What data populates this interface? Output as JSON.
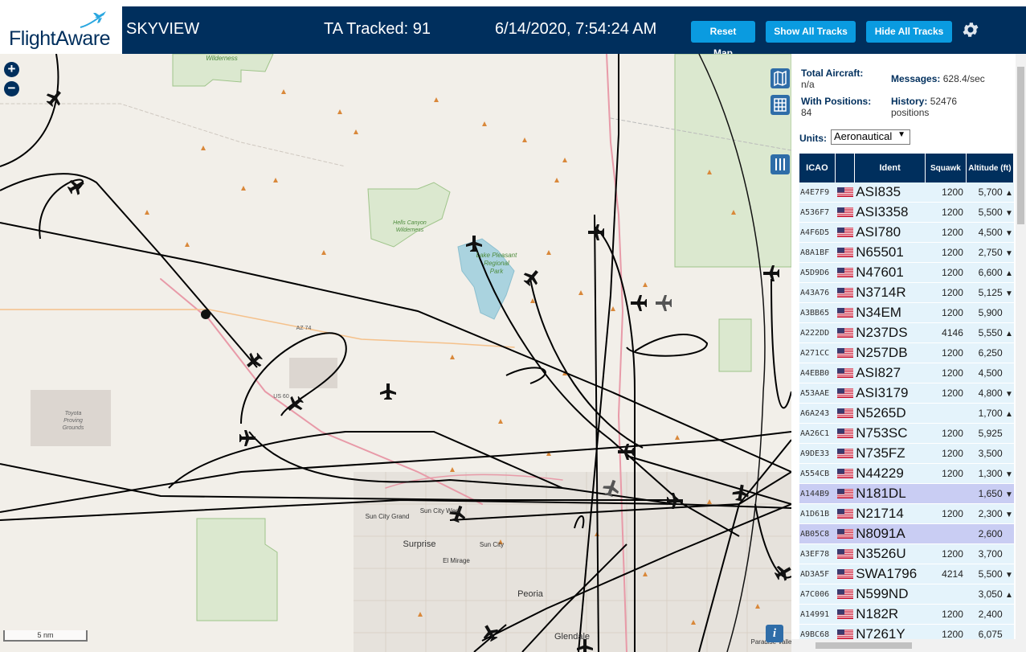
{
  "header": {
    "logo": "FlightAware",
    "app_title": "SKYVIEW",
    "ta_tracked": "TA Tracked: 91",
    "datetime": "6/14/2020, 7:54:24 AM",
    "buttons": {
      "reset_map": "Reset Map",
      "show_all_tracks": "Show All Tracks",
      "hide_all_tracks": "Hide All Tracks"
    },
    "settings_icon": "gear-icon",
    "background": "#002f5d",
    "button_color": "#0a9be0"
  },
  "map": {
    "zoom_in": "+",
    "zoom_out": "−",
    "scale": "5 nm",
    "info": "i",
    "labels": {
      "wilderness_top": "Wilderness",
      "hells_canyon": "Hells Canyon",
      "hells_canyon2": "Wilderness",
      "lake_pleasant": "Lake Pleasant",
      "regional": "Regional",
      "park": "Park",
      "toyota": "Toyota",
      "proving": "Proving",
      "grounds": "Grounds",
      "az74": "AZ 74",
      "us60": "US 60",
      "sun_city_grand": "Sun City Grand",
      "sun_city_west": "Sun City West",
      "sun_city": "Sun City",
      "surprise": "Surprise",
      "el_mirage": "El Mirage",
      "peoria": "Peoria",
      "glendale": "Glendale",
      "paradise_valley": "Paradise Valle"
    }
  },
  "sidebar": {
    "total_aircraft_label": "Total Aircraft:",
    "total_aircraft_value": "n/a",
    "with_positions_label": "With Positions:",
    "with_positions_value": "84",
    "messages_label": "Messages:",
    "messages_value": "628.4/sec",
    "history_label": "History:",
    "history_value": "52476",
    "history_unit": "positions",
    "units_label": "Units:",
    "units_value": "Aeronautical",
    "columns": [
      "ICAO",
      "",
      "Ident",
      "Squawk",
      "Altitude (ft)"
    ],
    "rows": [
      {
        "icao": "A4E7F9",
        "ident": "ASI835",
        "squawk": "1200",
        "altitude": "5,700",
        "trend": "▲"
      },
      {
        "icao": "A536F7",
        "ident": "ASI3358",
        "squawk": "1200",
        "altitude": "5,500",
        "trend": "▼"
      },
      {
        "icao": "A4F6D5",
        "ident": "ASI780",
        "squawk": "1200",
        "altitude": "4,500",
        "trend": "▼"
      },
      {
        "icao": "A8A1BF",
        "ident": "N65501",
        "squawk": "1200",
        "altitude": "2,750",
        "trend": "▼"
      },
      {
        "icao": "A5D9D6",
        "ident": "N47601",
        "squawk": "1200",
        "altitude": "6,600",
        "trend": "▲"
      },
      {
        "icao": "A43A76",
        "ident": "N3714R",
        "squawk": "1200",
        "altitude": "5,125",
        "trend": "▼"
      },
      {
        "icao": "A3BB65",
        "ident": "N34EM",
        "squawk": "1200",
        "altitude": "5,900",
        "trend": ""
      },
      {
        "icao": "A222DD",
        "ident": "N237DS",
        "squawk": "4146",
        "altitude": "5,550",
        "trend": "▲"
      },
      {
        "icao": "A271CC",
        "ident": "N257DB",
        "squawk": "1200",
        "altitude": "6,250",
        "trend": ""
      },
      {
        "icao": "A4EBB0",
        "ident": "ASI827",
        "squawk": "1200",
        "altitude": "4,500",
        "trend": ""
      },
      {
        "icao": "A53AAE",
        "ident": "ASI3179",
        "squawk": "1200",
        "altitude": "4,800",
        "trend": "▼"
      },
      {
        "icao": "A6A243",
        "ident": "N5265D",
        "squawk": "",
        "altitude": "1,700",
        "trend": "▲"
      },
      {
        "icao": "AA26C1",
        "ident": "N753SC",
        "squawk": "1200",
        "altitude": "5,925",
        "trend": ""
      },
      {
        "icao": "A9DE33",
        "ident": "N735FZ",
        "squawk": "1200",
        "altitude": "3,500",
        "trend": ""
      },
      {
        "icao": "A554CB",
        "ident": "N44229",
        "squawk": "1200",
        "altitude": "1,300",
        "trend": "▼"
      },
      {
        "icao": "A144B9",
        "ident": "N181DL",
        "squawk": "",
        "altitude": "1,650",
        "trend": "▼",
        "highlight": true
      },
      {
        "icao": "A1D61B",
        "ident": "N21714",
        "squawk": "1200",
        "altitude": "2,300",
        "trend": "▼"
      },
      {
        "icao": "AB05C8",
        "ident": "N8091A",
        "squawk": "",
        "altitude": "2,600",
        "trend": "",
        "highlight": true
      },
      {
        "icao": "A3EF78",
        "ident": "N3526U",
        "squawk": "1200",
        "altitude": "3,700",
        "trend": ""
      },
      {
        "icao": "AD3A5F",
        "ident": "SWA1796",
        "squawk": "4214",
        "altitude": "5,500",
        "trend": "▼"
      },
      {
        "icao": "A7C006",
        "ident": "N599ND",
        "squawk": "",
        "altitude": "3,050",
        "trend": "▲"
      },
      {
        "icao": "A14991",
        "ident": "N182R",
        "squawk": "1200",
        "altitude": "2,400",
        "trend": ""
      },
      {
        "icao": "A9BC68",
        "ident": "N7261Y",
        "squawk": "1200",
        "altitude": "6,075",
        "trend": ""
      }
    ]
  }
}
